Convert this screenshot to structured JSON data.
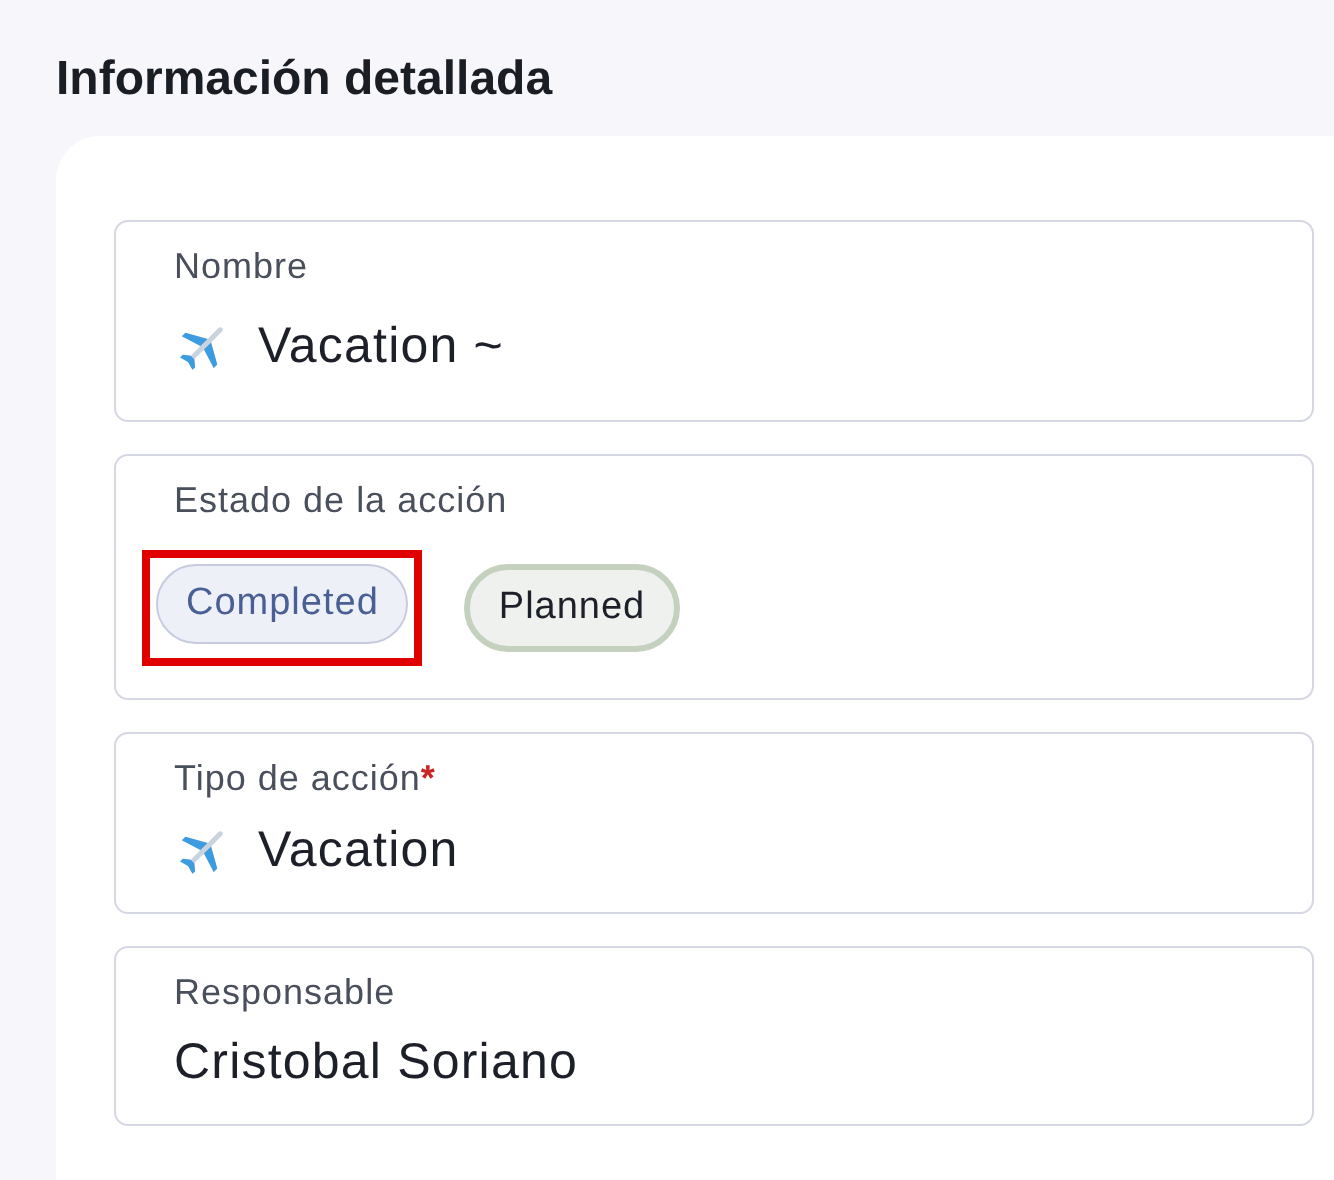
{
  "title": "Información detallada",
  "fields": [
    {
      "kind": "icon-text",
      "label": "Nombre",
      "value": "Vacation ~"
    },
    {
      "kind": "chips",
      "label": "Estado de la acción",
      "options": [
        {
          "label": "Completed",
          "selected": true,
          "highlighted": true
        },
        {
          "label": "Planned",
          "selected": false,
          "highlighted": false
        }
      ]
    },
    {
      "kind": "icon-text",
      "label": "Tipo de acción",
      "required_mark": "*",
      "value": "Vacation"
    },
    {
      "kind": "text",
      "label": "Responsable",
      "value": "Cristobal Soriano"
    }
  ]
}
